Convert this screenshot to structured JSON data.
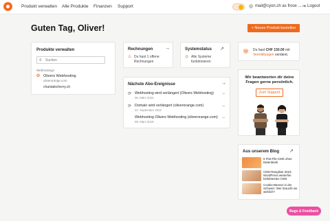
{
  "nav": {
    "items": [
      "Produkt verwalten",
      "Alle Produkte",
      "Finanzen",
      "Support"
    ],
    "user": "mail@cyon.ch as froox ...",
    "logout": "Logout"
  },
  "greeting": "Guten Tag, Oliver!",
  "new_product_button": "+ Neues Produkt bestellen",
  "manage": {
    "title": "Produkte verwalten",
    "search_placeholder": "Suchen",
    "group_label": "Webhostings",
    "item_title": "Olivers Webhosting",
    "item_domain": "oliverorange.com",
    "other_domain": "chantalecherry.ch"
  },
  "invoices": {
    "title": "Rechnungen",
    "line1": "Du hast 1 offene",
    "line2": "Rechnungen"
  },
  "status": {
    "title": "Systemstatus",
    "line1": "Alle Systeme",
    "line2": "funktionieren"
  },
  "credit": {
    "prefix": "Du hast ",
    "amount": "CHF 150.00",
    "suffix": " mit",
    "link": "Vermittlungen",
    "end": " verdient."
  },
  "events": {
    "title": "Nächste Abo-Ereignisse",
    "items": [
      {
        "title": "Webhosting wird verlängert (Olivers Webhosting)",
        "date": "05. März 2022"
      },
      {
        "title": "Domain wird verlängert (oliverorange.com)",
        "date": "21. September 2022"
      },
      {
        "title": "Webhosting Olivers Webhosting (oliverorange.com)",
        "date": "08. März 2019"
      }
    ]
  },
  "support": {
    "heading": "Wir beantworten dir deine Fragen gerne persönlich.",
    "button": "Zum Support"
  },
  "blog": {
    "title": "Aus unserem Blog",
    "posts": [
      "5 Flat-File-CMS ohne Datenbank",
      "CMS-Rangliste 2024: WordPress weiterhin beliebtestes CMS",
      "Cookie-Banner in der Schweiz: Wer braucht sie wirklich?"
    ]
  },
  "feedback_button": "Bugs & Feedback",
  "colors": {
    "accent": "#ef6a1d",
    "feedback": "#ec4fa1",
    "background": "#f5f5f4"
  }
}
